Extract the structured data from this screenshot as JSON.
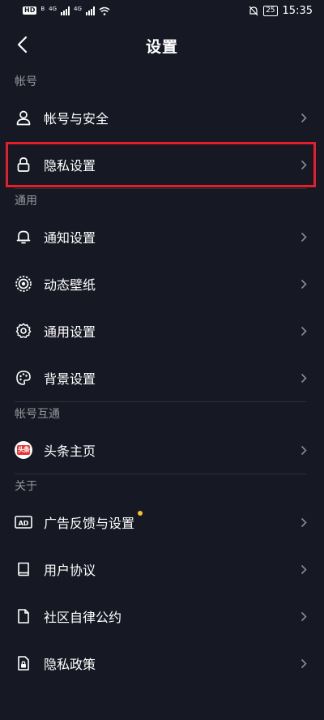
{
  "status_bar": {
    "left_badge": "HD",
    "left_small": "B",
    "net1": "4G",
    "net2": "4G",
    "battery": "25",
    "time": "15:35"
  },
  "header": {
    "title": "设置"
  },
  "sections": {
    "account": {
      "title": "帐号",
      "items": [
        {
          "label": "帐号与安全",
          "icon": "user-icon"
        },
        {
          "label": "隐私设置",
          "icon": "lock-icon"
        }
      ]
    },
    "general": {
      "title": "通用",
      "items": [
        {
          "label": "通知设置",
          "icon": "bell-icon"
        },
        {
          "label": "动态壁纸",
          "icon": "live-wallpaper-icon"
        },
        {
          "label": "通用设置",
          "icon": "gear-icon"
        },
        {
          "label": "背景设置",
          "icon": "palette-icon"
        }
      ]
    },
    "interop": {
      "title": "帐号互通",
      "items": [
        {
          "label": "头条主页",
          "icon": "toutiao-logo-icon",
          "logo_text": "头条"
        }
      ]
    },
    "about": {
      "title": "关于",
      "items": [
        {
          "label": "广告反馈与设置",
          "icon": "ad-icon",
          "icon_text": "AD"
        },
        {
          "label": "用户协议",
          "icon": "book-icon"
        },
        {
          "label": "社区自律公约",
          "icon": "document-icon"
        },
        {
          "label": "隐私政策",
          "icon": "lock-document-icon"
        }
      ]
    }
  },
  "colors": {
    "background": "#161823",
    "highlight_border": "#e61e2a",
    "notification_dot": "#f5c22b"
  }
}
